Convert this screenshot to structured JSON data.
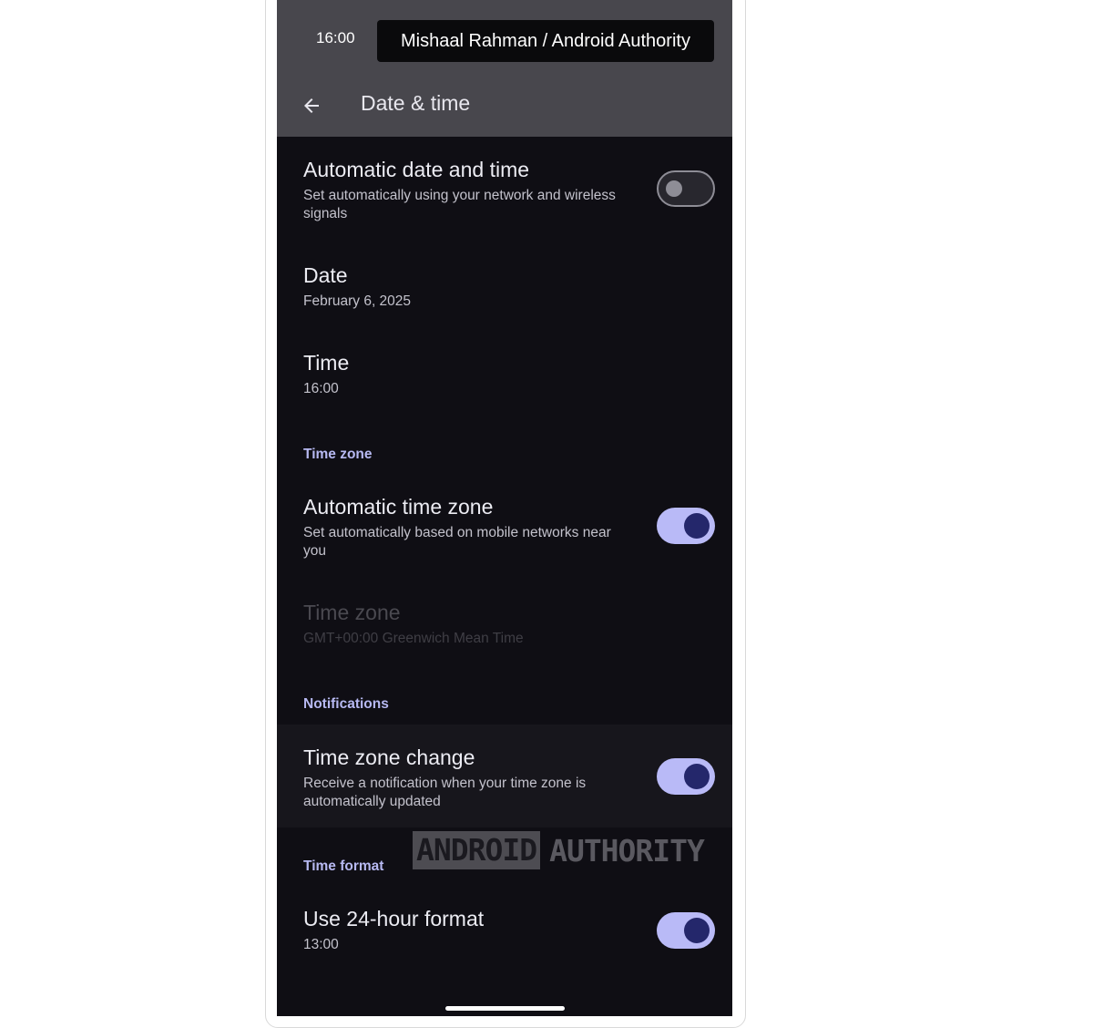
{
  "status_bar": {
    "time": "16:00"
  },
  "credit": {
    "text": "Mishaal Rahman / Android Authority"
  },
  "app_bar": {
    "back_icon": "arrow-back-icon",
    "title": "Date & time"
  },
  "settings": {
    "automatic_date_time": {
      "title": "Automatic date and time",
      "summary": "Set automatically using your network and wireless signals",
      "enabled": false
    },
    "date": {
      "title": "Date",
      "value": "February 6, 2025"
    },
    "time": {
      "title": "Time",
      "value": "16:00"
    },
    "time_zone_section": {
      "header": "Time zone"
    },
    "automatic_time_zone": {
      "title": "Automatic time zone",
      "summary": "Set automatically based on mobile networks near you",
      "enabled": true
    },
    "time_zone": {
      "title": "Time zone",
      "value": "GMT+00:00 Greenwich Mean Time",
      "disabled": true
    },
    "notifications_section": {
      "header": "Notifications"
    },
    "time_zone_change": {
      "title": "Time zone change",
      "summary": "Receive a notification when your time zone is automatically updated",
      "enabled": true
    },
    "time_format_section": {
      "header": "Time format"
    },
    "use_24_hour": {
      "title": "Use 24-hour format",
      "value": "13:00",
      "enabled": true
    }
  },
  "watermark": {
    "part1": "ANDROID",
    "part2": "AUTHORITY"
  },
  "colors": {
    "accent": "#b7b9f2",
    "switch_on_track": "#b9baf7",
    "switch_on_thumb": "#24276b",
    "background": "#0f0e14",
    "app_bar": "#48474d"
  }
}
